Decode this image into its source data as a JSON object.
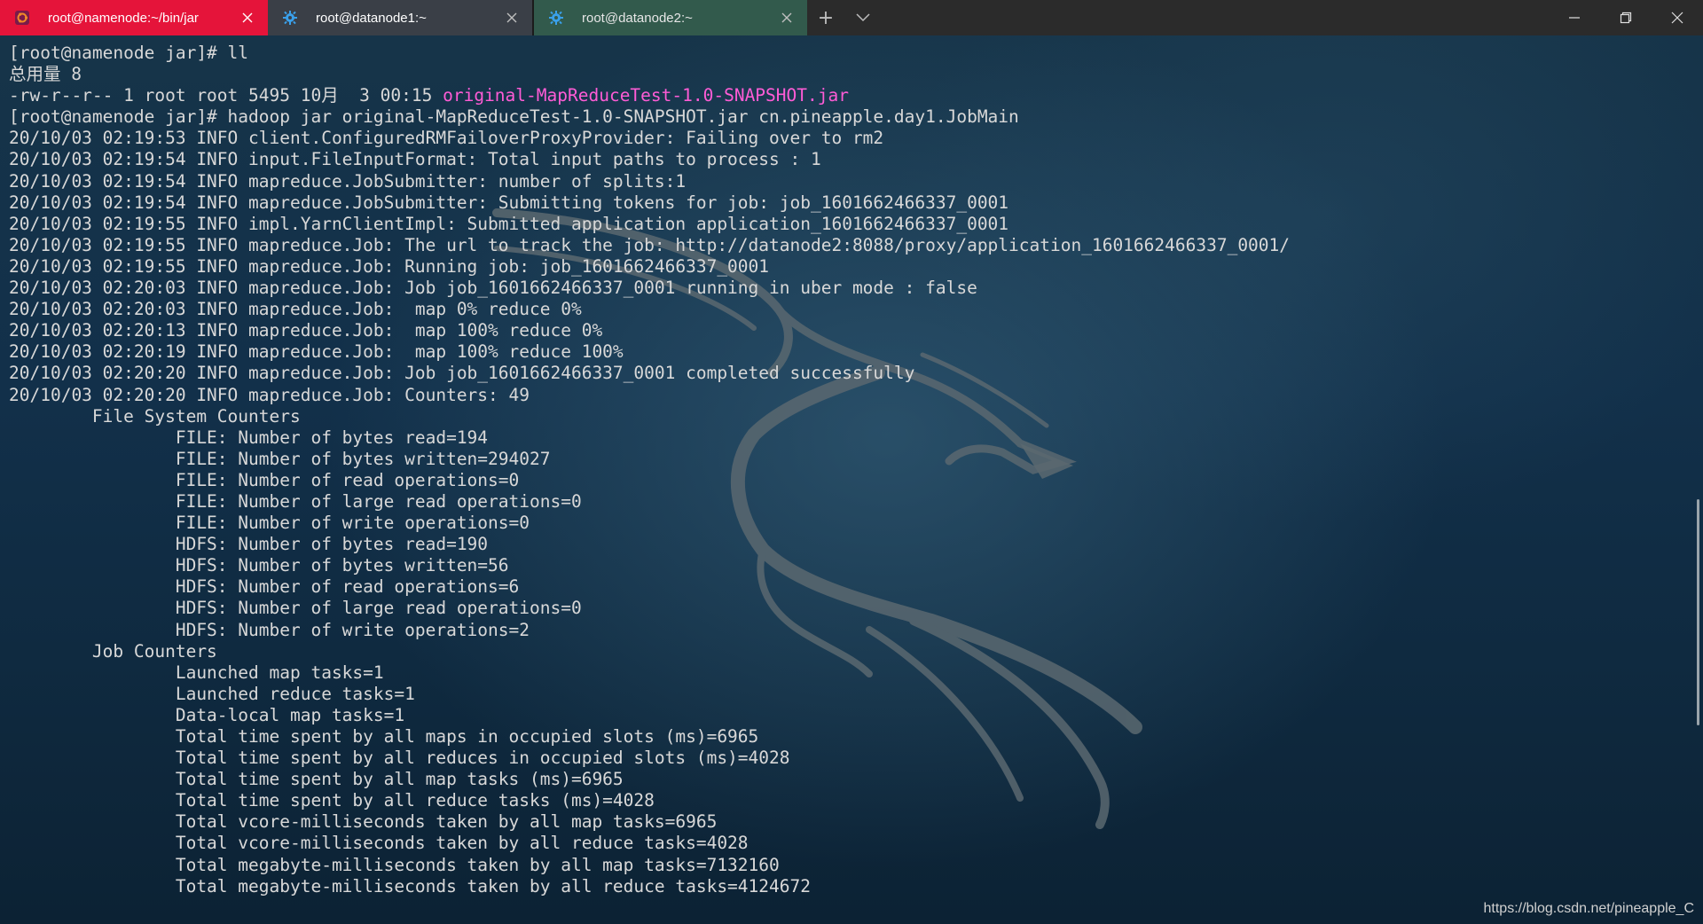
{
  "tabs": [
    {
      "label": "root@namenode:~/bin/jar",
      "icon": "ubuntu-icon",
      "active": true,
      "color": "#e5143a"
    },
    {
      "label": "root@datanode1:~",
      "icon": "gear-icon",
      "active": false,
      "color": "#3a3f47"
    },
    {
      "label": "root@datanode2:~",
      "icon": "gear-icon",
      "active": false,
      "color": "#325a4c"
    }
  ],
  "tab_controls": {
    "new_tab": "+",
    "dropdown": "⌄"
  },
  "window_controls": {
    "minimize": "minimize-icon",
    "restore": "restore-icon",
    "close": "close-icon"
  },
  "terminal": {
    "lines": [
      {
        "segments": [
          {
            "text": "[root@namenode jar]# ll"
          }
        ]
      },
      {
        "segments": [
          {
            "text": "总用量 8"
          }
        ]
      },
      {
        "segments": [
          {
            "text": "-rw-r--r-- 1 root root 5495 10月  3 00:15 "
          },
          {
            "text": "original-MapReduceTest-1.0-SNAPSHOT.jar",
            "highlight": true
          }
        ]
      },
      {
        "segments": [
          {
            "text": "[root@namenode jar]# hadoop jar original-MapReduceTest-1.0-SNAPSHOT.jar cn.pineapple.day1.JobMain"
          }
        ]
      },
      {
        "segments": [
          {
            "text": "20/10/03 02:19:53 INFO client.ConfiguredRMFailoverProxyProvider: Failing over to rm2"
          }
        ]
      },
      {
        "segments": [
          {
            "text": "20/10/03 02:19:54 INFO input.FileInputFormat: Total input paths to process : 1"
          }
        ]
      },
      {
        "segments": [
          {
            "text": "20/10/03 02:19:54 INFO mapreduce.JobSubmitter: number of splits:1"
          }
        ]
      },
      {
        "segments": [
          {
            "text": "20/10/03 02:19:54 INFO mapreduce.JobSubmitter: Submitting tokens for job: job_1601662466337_0001"
          }
        ]
      },
      {
        "segments": [
          {
            "text": "20/10/03 02:19:55 INFO impl.YarnClientImpl: Submitted application application_1601662466337_0001"
          }
        ]
      },
      {
        "segments": [
          {
            "text": "20/10/03 02:19:55 INFO mapreduce.Job: The url to track the job: http://datanode2:8088/proxy/application_1601662466337_0001/"
          }
        ]
      },
      {
        "segments": [
          {
            "text": "20/10/03 02:19:55 INFO mapreduce.Job: Running job: job_1601662466337_0001"
          }
        ]
      },
      {
        "segments": [
          {
            "text": "20/10/03 02:20:03 INFO mapreduce.Job: Job job_1601662466337_0001 running in uber mode : false"
          }
        ]
      },
      {
        "segments": [
          {
            "text": "20/10/03 02:20:03 INFO mapreduce.Job:  map 0% reduce 0%"
          }
        ]
      },
      {
        "segments": [
          {
            "text": "20/10/03 02:20:13 INFO mapreduce.Job:  map 100% reduce 0%"
          }
        ]
      },
      {
        "segments": [
          {
            "text": "20/10/03 02:20:19 INFO mapreduce.Job:  map 100% reduce 100%"
          }
        ]
      },
      {
        "segments": [
          {
            "text": "20/10/03 02:20:20 INFO mapreduce.Job: Job job_1601662466337_0001 completed successfully"
          }
        ]
      },
      {
        "segments": [
          {
            "text": "20/10/03 02:20:20 INFO mapreduce.Job: Counters: 49"
          }
        ]
      },
      {
        "segments": [
          {
            "text": "        File System Counters"
          }
        ]
      },
      {
        "segments": [
          {
            "text": "                FILE: Number of bytes read=194"
          }
        ]
      },
      {
        "segments": [
          {
            "text": "                FILE: Number of bytes written=294027"
          }
        ]
      },
      {
        "segments": [
          {
            "text": "                FILE: Number of read operations=0"
          }
        ]
      },
      {
        "segments": [
          {
            "text": "                FILE: Number of large read operations=0"
          }
        ]
      },
      {
        "segments": [
          {
            "text": "                FILE: Number of write operations=0"
          }
        ]
      },
      {
        "segments": [
          {
            "text": "                HDFS: Number of bytes read=190"
          }
        ]
      },
      {
        "segments": [
          {
            "text": "                HDFS: Number of bytes written=56"
          }
        ]
      },
      {
        "segments": [
          {
            "text": "                HDFS: Number of read operations=6"
          }
        ]
      },
      {
        "segments": [
          {
            "text": "                HDFS: Number of large read operations=0"
          }
        ]
      },
      {
        "segments": [
          {
            "text": "                HDFS: Number of write operations=2"
          }
        ]
      },
      {
        "segments": [
          {
            "text": "        Job Counters"
          }
        ]
      },
      {
        "segments": [
          {
            "text": "                Launched map tasks=1"
          }
        ]
      },
      {
        "segments": [
          {
            "text": "                Launched reduce tasks=1"
          }
        ]
      },
      {
        "segments": [
          {
            "text": "                Data-local map tasks=1"
          }
        ]
      },
      {
        "segments": [
          {
            "text": "                Total time spent by all maps in occupied slots (ms)=6965"
          }
        ]
      },
      {
        "segments": [
          {
            "text": "                Total time spent by all reduces in occupied slots (ms)=4028"
          }
        ]
      },
      {
        "segments": [
          {
            "text": "                Total time spent by all map tasks (ms)=6965"
          }
        ]
      },
      {
        "segments": [
          {
            "text": "                Total time spent by all reduce tasks (ms)=4028"
          }
        ]
      },
      {
        "segments": [
          {
            "text": "                Total vcore-milliseconds taken by all map tasks=6965"
          }
        ]
      },
      {
        "segments": [
          {
            "text": "                Total vcore-milliseconds taken by all reduce tasks=4028"
          }
        ]
      },
      {
        "segments": [
          {
            "text": "                Total megabyte-milliseconds taken by all map tasks=7132160"
          }
        ]
      },
      {
        "segments": [
          {
            "text": "                Total megabyte-milliseconds taken by all reduce tasks=4124672"
          }
        ]
      }
    ],
    "highlight_color": "#ff5cd6",
    "text_color": "#d8d8d8"
  },
  "watermark": "https://blog.csdn.net/pineapple_C"
}
